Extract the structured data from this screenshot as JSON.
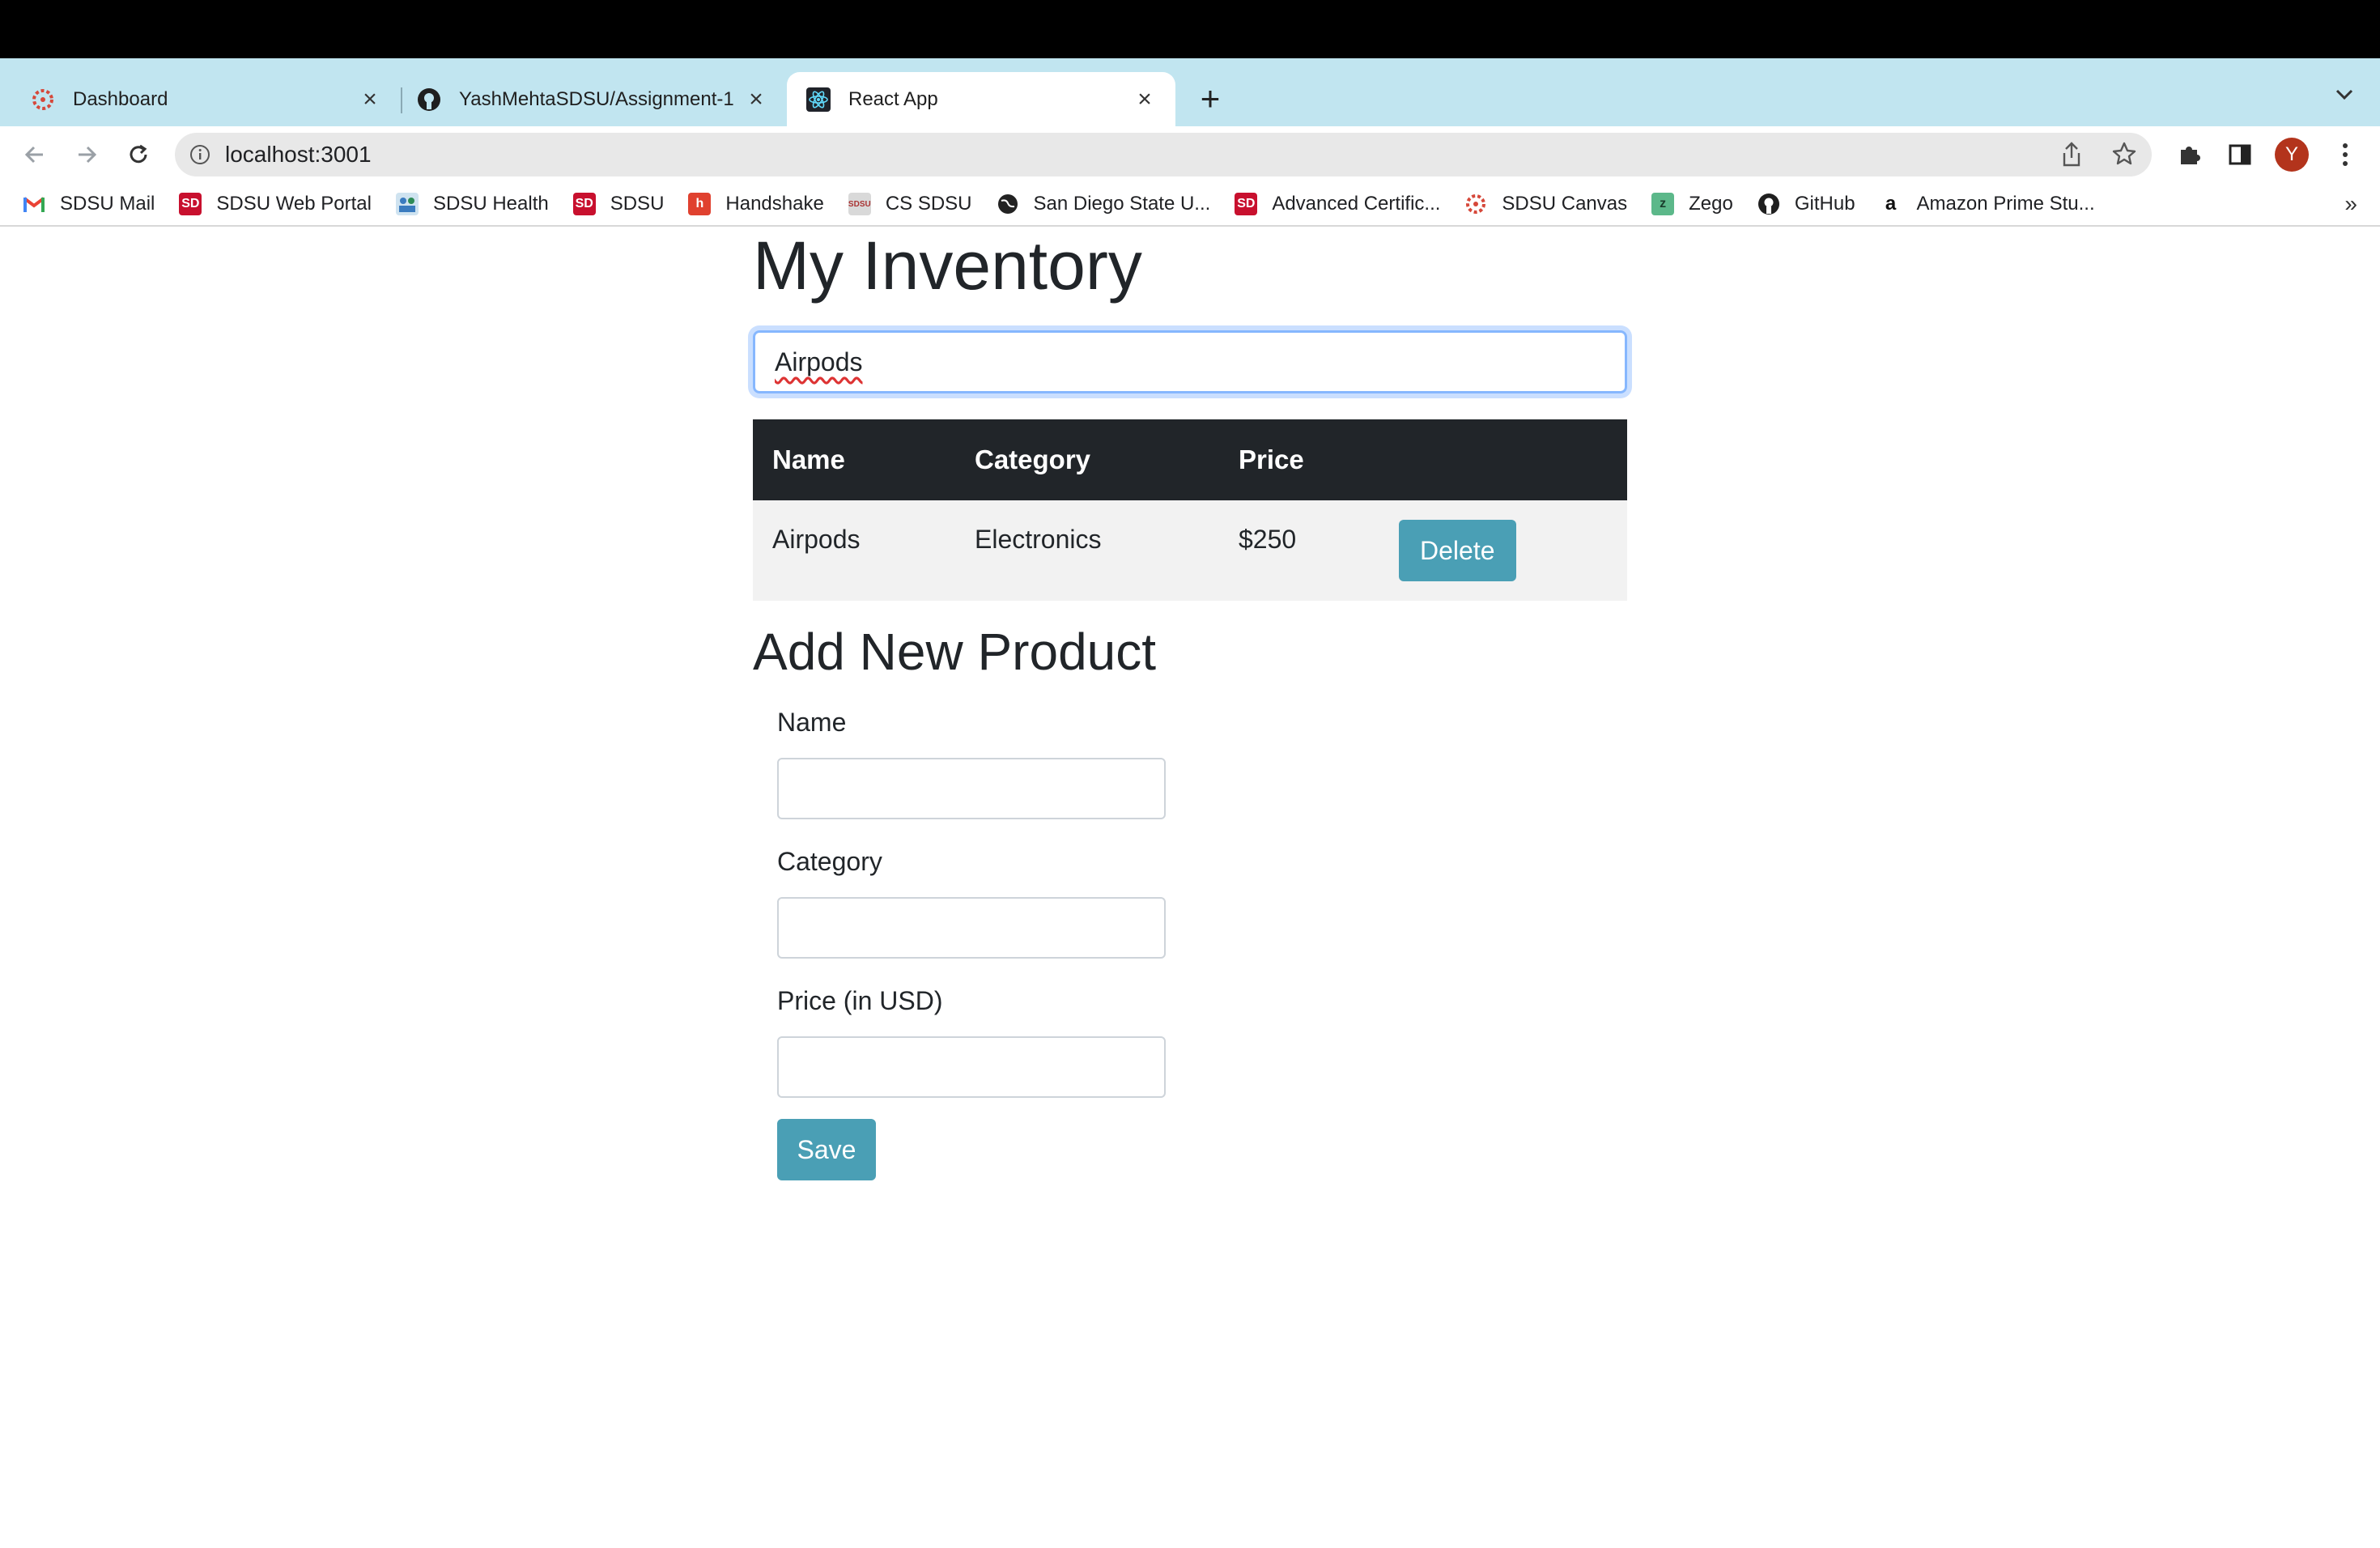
{
  "browser": {
    "tabs": [
      {
        "title": "Dashboard"
      },
      {
        "title": "YashMehtaSDSU/Assignment-1"
      },
      {
        "title": "React App"
      }
    ],
    "new_tab_symbol": "+",
    "url": "localhost:3001",
    "profile_initial": "Y",
    "bookmarks": [
      {
        "label": "SDSU Mail",
        "icon": "gmail-icon"
      },
      {
        "label": "SDSU Web Portal",
        "icon": "sdsu-icon"
      },
      {
        "label": "SDSU Health",
        "icon": "health-icon"
      },
      {
        "label": "SDSU",
        "icon": "sdsu-icon"
      },
      {
        "label": "Handshake",
        "icon": "handshake-icon"
      },
      {
        "label": "CS SDSU",
        "icon": "cs-icon"
      },
      {
        "label": "San Diego State U...",
        "icon": "globe-icon"
      },
      {
        "label": "Advanced Certific...",
        "icon": "sdsu-icon"
      },
      {
        "label": "SDSU Canvas",
        "icon": "canvas-icon"
      },
      {
        "label": "Zego",
        "icon": "zego-icon"
      },
      {
        "label": "GitHub",
        "icon": "github-icon"
      },
      {
        "label": "Amazon Prime Stu...",
        "icon": "amazon-icon"
      }
    ],
    "bookmarks_more": "»"
  },
  "app": {
    "title": "My Inventory",
    "search": {
      "value": "Airpods"
    },
    "table": {
      "headers": [
        "Name",
        "Category",
        "Price"
      ],
      "rows": [
        {
          "name": "Airpods",
          "category": "Electronics",
          "price": "$250",
          "action": "Delete"
        }
      ]
    },
    "form": {
      "title": "Add New Product",
      "name_label": "Name",
      "category_label": "Category",
      "price_label": "Price (in USD)",
      "save_label": "Save"
    }
  },
  "colors": {
    "tabstrip": "#c1e5f0",
    "table_header": "#212529",
    "button": "#4a9fb5",
    "avatar": "#b3341c"
  }
}
